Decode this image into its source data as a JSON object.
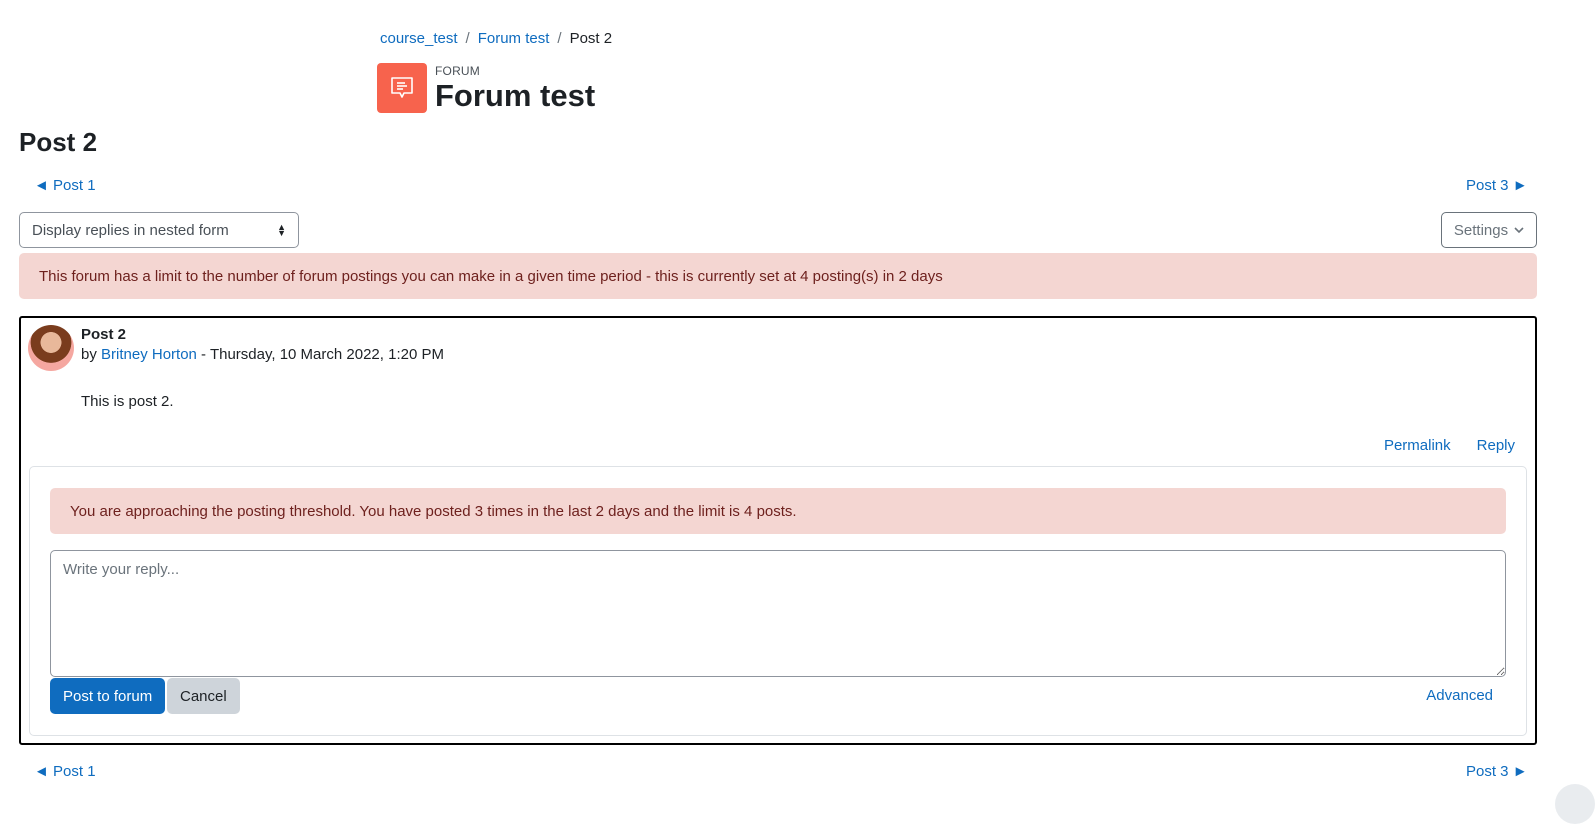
{
  "breadcrumb": {
    "items": [
      "course_test",
      "Forum test"
    ],
    "current": "Post 2"
  },
  "activity": {
    "type_label": "FORUM",
    "title": "Forum test",
    "icon_color": "#f7634d"
  },
  "page_title": "Post 2",
  "nav": {
    "prev": "◄ Post 1",
    "next": "Post 3 ►"
  },
  "display_select": {
    "selected": "Display replies in nested form"
  },
  "settings_label": "Settings",
  "alerts": {
    "forum_limit": "This forum has a limit to the number of forum postings you can make in a given time period - this is currently set at 4 posting(s) in 2 days",
    "threshold": "You are approaching the posting threshold. You have posted 3 times in the last 2 days and the limit is 4 posts."
  },
  "post": {
    "subject": "Post 2",
    "by_prefix": "by",
    "author": "Britney Horton",
    "date_suffix": " - Thursday, 10 March 2022, 1:20 PM",
    "content": "This is post 2.",
    "actions": {
      "permalink": "Permalink",
      "reply": "Reply"
    }
  },
  "reply_form": {
    "placeholder": "Write your reply...",
    "submit": "Post to forum",
    "cancel": "Cancel",
    "advanced": "Advanced"
  },
  "colors": {
    "link": "#0f6cbf",
    "alert_bg": "#f4d6d2",
    "alert_text": "#6e211e",
    "primary": "#0f6cbf"
  }
}
